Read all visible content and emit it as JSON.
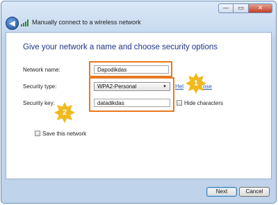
{
  "window": {
    "title": "Manually connect to a wireless network",
    "caption": {
      "minimize": "▭",
      "maximize": "▭",
      "close": "✕"
    }
  },
  "page": {
    "heading": "Give your network a name and choose security options",
    "network_name": {
      "label": "Network name:",
      "value": "Dapodikdas"
    },
    "security_type": {
      "label": "Security type:",
      "value": "WPA2-Personal"
    },
    "help_link": {
      "visible_start": "Hel",
      "visible_end": "ose"
    },
    "security_key": {
      "label": "Security key:",
      "value": "datadikdas"
    },
    "hide_characters": {
      "label": "Hide characters",
      "checked": false
    },
    "save_network": {
      "label": "Save this network",
      "checked": false
    }
  },
  "annotations": {
    "badge_1": "1",
    "badge_2": "2",
    "color": "#f2b91c",
    "outline_color": "#e8781d"
  },
  "footer": {
    "next_label": "Next",
    "cancel_label": "Cancel"
  },
  "icons": [
    "back-arrow-icon",
    "wireless-signal-icon",
    "minimize-icon",
    "maximize-icon",
    "close-icon",
    "dropdown-arrow-icon"
  ]
}
